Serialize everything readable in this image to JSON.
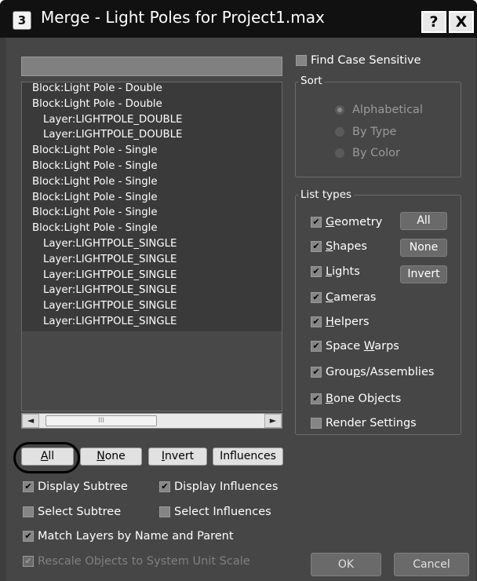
{
  "window": {
    "title": "Merge - Light Poles for Project1.max",
    "app_icon_glyph": "3",
    "help_label": "?",
    "close_label": "X"
  },
  "list": {
    "items": [
      {
        "label": "Block:Light Pole - Double",
        "level": 0
      },
      {
        "label": "Block:Light Pole - Double",
        "level": 0
      },
      {
        "label": "Layer:LIGHTPOLE_DOUBLE",
        "level": 1
      },
      {
        "label": "Layer:LIGHTPOLE_DOUBLE",
        "level": 1
      },
      {
        "label": "Block:Light Pole - Single",
        "level": 0
      },
      {
        "label": "Block:Light Pole - Single",
        "level": 0
      },
      {
        "label": "Block:Light Pole - Single",
        "level": 0
      },
      {
        "label": "Block:Light Pole - Single",
        "level": 0
      },
      {
        "label": "Block:Light Pole - Single",
        "level": 0
      },
      {
        "label": "Block:Light Pole - Single",
        "level": 0
      },
      {
        "label": "Layer:LIGHTPOLE_SINGLE",
        "level": 1
      },
      {
        "label": "Layer:LIGHTPOLE_SINGLE",
        "level": 1
      },
      {
        "label": "Layer:LIGHTPOLE_SINGLE",
        "level": 1
      },
      {
        "label": "Layer:LIGHTPOLE_SINGLE",
        "level": 1
      },
      {
        "label": "Layer:LIGHTPOLE_SINGLE",
        "level": 1
      },
      {
        "label": "Layer:LIGHTPOLE_SINGLE",
        "level": 1
      }
    ],
    "scroll": {
      "left_arrow": "◄",
      "right_arrow": "►",
      "thumb_grip": "III"
    }
  },
  "selection_buttons": {
    "all": {
      "key": "A",
      "rest": "ll"
    },
    "none": {
      "key": "N",
      "rest": "one"
    },
    "invert": {
      "key": "I",
      "rest": "nvert"
    },
    "influences": "Influences"
  },
  "options": {
    "display_subtree": {
      "label": "Display Subtree",
      "checked": true
    },
    "display_influences": {
      "label": "Display Influences",
      "checked": true
    },
    "select_subtree": {
      "label": "Select Subtree",
      "checked": false
    },
    "select_influences": {
      "label": "Select Influences",
      "checked": false
    },
    "match_layers": {
      "label": "Match Layers by Name and Parent",
      "checked": true
    },
    "rescale": {
      "label": "Rescale Objects to System Unit Scale",
      "checked": true,
      "disabled": true
    }
  },
  "find_case_sensitive": {
    "label": "Find Case Sensitive",
    "checked": false
  },
  "sort": {
    "title": "Sort",
    "options": [
      {
        "label": "Alphabetical",
        "selected": true
      },
      {
        "label": "By Type",
        "selected": false
      },
      {
        "label": "By Color",
        "selected": false
      }
    ]
  },
  "list_types": {
    "title": "List types",
    "items": [
      {
        "pre": "",
        "key": "G",
        "post": "eometry",
        "checked": true
      },
      {
        "pre": "",
        "key": "S",
        "post": "hapes",
        "checked": true
      },
      {
        "pre": "",
        "key": "L",
        "post": "ights",
        "checked": true
      },
      {
        "pre": "",
        "key": "C",
        "post": "ameras",
        "checked": true
      },
      {
        "pre": "",
        "key": "H",
        "post": "elpers",
        "checked": true
      },
      {
        "pre": "Space ",
        "key": "W",
        "post": "arps",
        "checked": true
      },
      {
        "pre": "Grou",
        "key": "p",
        "post": "s/Assemblies",
        "checked": true
      },
      {
        "pre": "",
        "key": "B",
        "post": "one Objects",
        "checked": true
      },
      {
        "pre": "Render Settings",
        "key": "",
        "post": "",
        "checked": false
      }
    ],
    "buttons": {
      "all": "All",
      "none": "None",
      "invert": "Invert"
    }
  },
  "footer": {
    "ok": "OK",
    "cancel": "Cancel"
  },
  "glyphs": {
    "check": "✔"
  }
}
